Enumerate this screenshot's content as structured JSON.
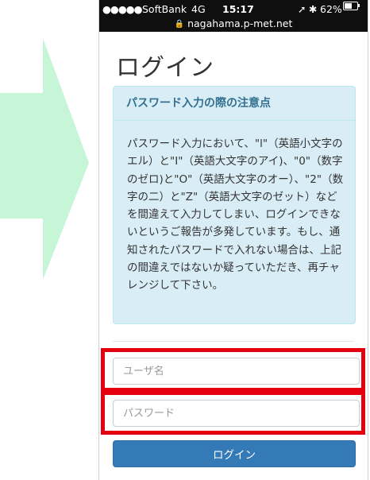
{
  "statusbar": {
    "signal": "●●●●●",
    "carrier": "SoftBank",
    "network": "4G",
    "time": "15:17",
    "location_icon": "➚",
    "bluetooth_icon": "✱",
    "battery_percent": "62%",
    "battery_level": 0.62,
    "lock_icon": "🔒",
    "url": "nagahama.p-met.net"
  },
  "page": {
    "title": "ログイン"
  },
  "notice": {
    "heading": "パスワード入力の際の注意点",
    "body": "パスワード入力において、\"l\"（英語小文字のエル）と\"I\"（英語大文字のアイ)、\"0\"（数字のゼロ)と\"O\"（英語大文字のオー）、\"2\"（数字の二）と\"Z\"（英語大文字のゼット）などを間違えて入力してしまい、ログインできないというご報告が多発しています。もし、通知されたパスワードで入れない場合は、上記の間違えではないか疑っていただき、再チャレンジして下さい。"
  },
  "form": {
    "username_placeholder": "ユーザ名",
    "username_value": "",
    "password_placeholder": "パスワード",
    "password_value": "",
    "login_label": "ログイン"
  },
  "colors": {
    "arrow": "#c6f5d8",
    "highlight": "#e5000f",
    "button": "#337ab7",
    "notice_bg": "#d9edf7",
    "notice_heading": "#31708f"
  }
}
